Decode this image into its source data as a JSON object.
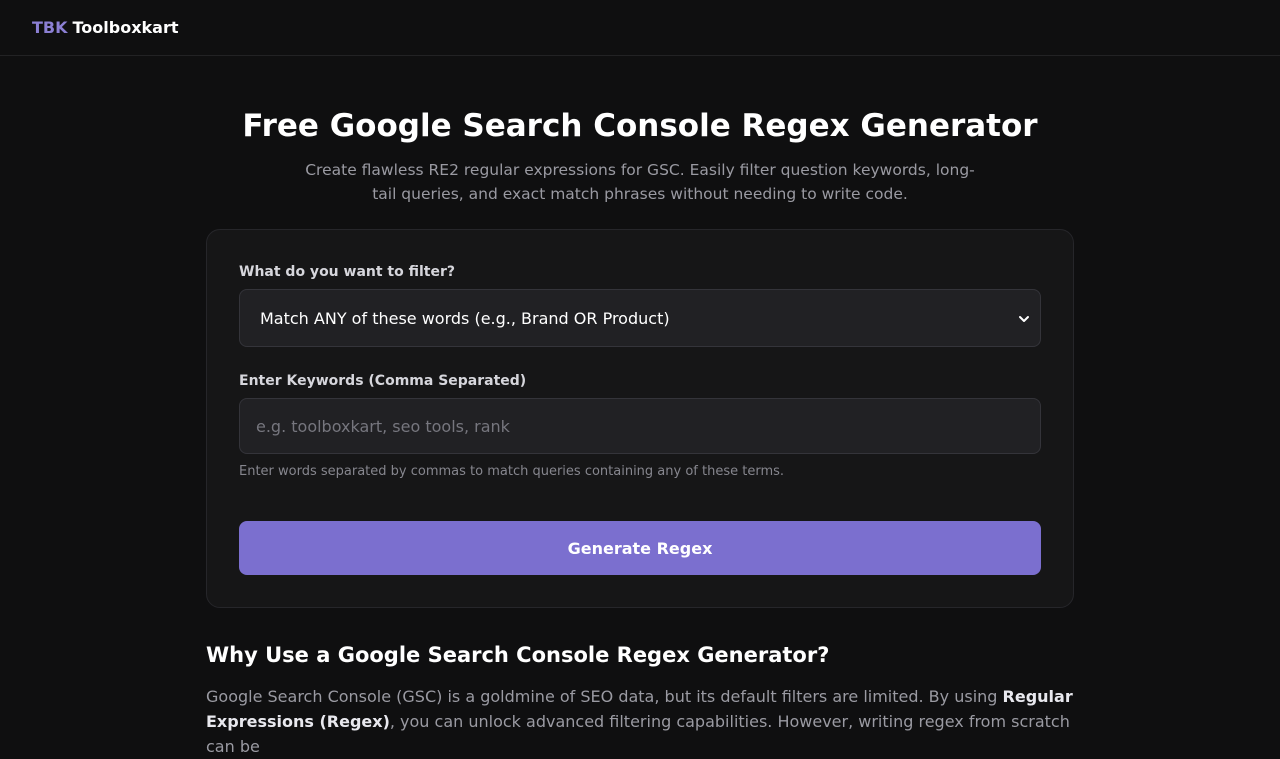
{
  "header": {
    "logo_mark": "TBK",
    "logo_text": "Toolboxkart"
  },
  "hero": {
    "title": "Free Google Search Console Regex Generator",
    "subtitle": "Create flawless RE2 regular expressions for GSC. Easily filter question keywords, long-tail queries, and exact match phrases without needing to write code."
  },
  "form": {
    "filter_label": "What do you want to filter?",
    "filter_selected": "Match ANY of these words (e.g., Brand OR Product)",
    "filter_icon": "chevron-down-icon",
    "keywords_label": "Enter Keywords (Comma Separated)",
    "keywords_value": "",
    "keywords_placeholder": "e.g. toolboxkart, seo tools, rank",
    "help_text": "Enter words separated by commas to match queries containing any of these terms.",
    "generate_label": "Generate Regex"
  },
  "info": {
    "heading": "Why Use a Google Search Console Regex Generator?",
    "body_start": "Google Search Console (GSC) is a goldmine of SEO data, but its default filters are limited. By using ",
    "body_strong": "Regular Expressions (Regex)",
    "body_end": ", you can unlock advanced filtering capabilities. However, writing regex from scratch can be"
  },
  "colors": {
    "background": "#0f0f10",
    "card": "#161617",
    "accent": "#7b6fcf",
    "logo_mark": "#8b7fd4"
  }
}
